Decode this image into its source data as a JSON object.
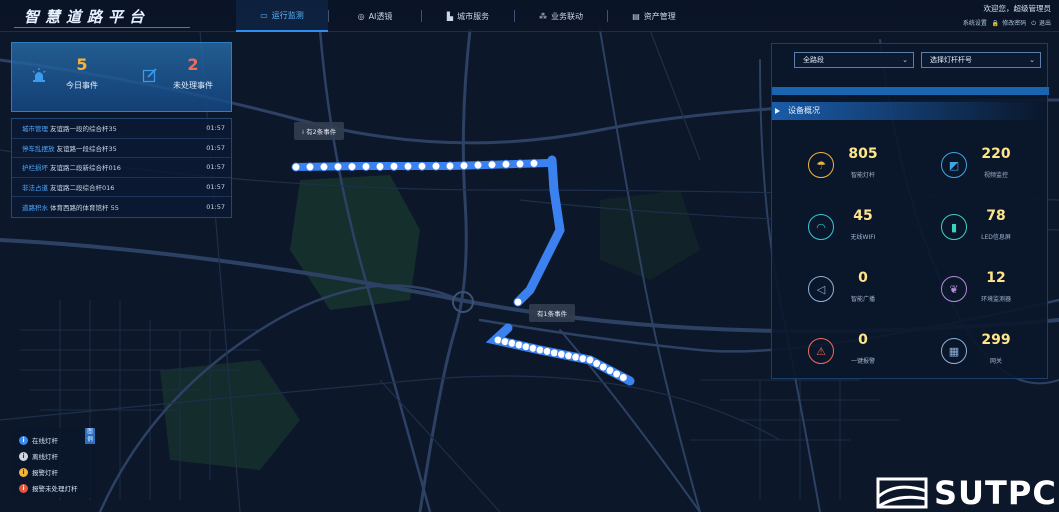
{
  "app": {
    "title": "智慧道路平台"
  },
  "nav": {
    "items": [
      {
        "label": "运行监测",
        "icon": "monitor-icon",
        "active": true
      },
      {
        "label": "AI透镜",
        "icon": "target-icon",
        "active": false
      },
      {
        "label": "城市服务",
        "icon": "building-icon",
        "active": false
      },
      {
        "label": "业务联动",
        "icon": "network-icon",
        "active": false
      },
      {
        "label": "资产管理",
        "icon": "box-icon",
        "active": false
      }
    ]
  },
  "user": {
    "welcome": "欢迎您，超级管理员",
    "links": [
      "系统设置",
      "修改密码",
      "退出"
    ]
  },
  "stats": {
    "today_events": {
      "value": "5",
      "label": "今日事件",
      "color": "#f2b33d"
    },
    "unhandled_events": {
      "value": "2",
      "label": "未处理事件",
      "color": "#f06b5a"
    }
  },
  "events": [
    {
      "type": "城市管理",
      "location": "友谊路一段的综合杆35",
      "time": "01:57"
    },
    {
      "type": "停车乱摆放",
      "location": "友谊路一段综合杆35",
      "time": "01:57"
    },
    {
      "type": "护栏损坏",
      "location": "友谊路二段新综合杆016",
      "time": "01:57"
    },
    {
      "type": "非法占道",
      "location": "友谊路二段综合杆016",
      "time": "01:57"
    },
    {
      "type": "道路积水",
      "location": "体育西路的体育馆杆 55",
      "time": "01:57"
    }
  ],
  "legend": {
    "title": "图例",
    "items": [
      {
        "label": "在线灯杆",
        "color": "#3b8bf0"
      },
      {
        "label": "离线灯杆",
        "color": "#d0d6de"
      },
      {
        "label": "报警灯杆",
        "color": "#f2b33d"
      },
      {
        "label": "报警未处理灯杆",
        "color": "#e4553f"
      }
    ]
  },
  "filters": {
    "road": "全路段",
    "pole": "选择灯杆杆号"
  },
  "device_overview": {
    "title": "设备概况",
    "items": [
      {
        "value": "805",
        "label": "智能灯杆",
        "icon": "streetlight-icon",
        "color": "#f2b33d"
      },
      {
        "value": "220",
        "label": "视频监控",
        "icon": "camera-icon",
        "color": "#3fa6e6"
      },
      {
        "value": "45",
        "label": "无线WIFI",
        "icon": "wifi-icon",
        "color": "#35c8d8"
      },
      {
        "value": "78",
        "label": "LED信息屏",
        "icon": "screen-icon",
        "color": "#3fd0c4"
      },
      {
        "value": "0",
        "label": "智能广播",
        "icon": "speaker-icon",
        "color": "#8eb0d8"
      },
      {
        "value": "12",
        "label": "环境监测器",
        "icon": "leaf-icon",
        "color": "#b58ad8"
      },
      {
        "value": "0",
        "label": "一键报警",
        "icon": "alarm-icon",
        "color": "#f06b5a"
      },
      {
        "value": "299",
        "label": "网关",
        "icon": "gateway-icon",
        "color": "#8eb0d8"
      }
    ]
  },
  "map": {
    "popup_1": "有2条事件",
    "popup_2": "有1条事件"
  },
  "logo": {
    "text": "SUTPC"
  }
}
